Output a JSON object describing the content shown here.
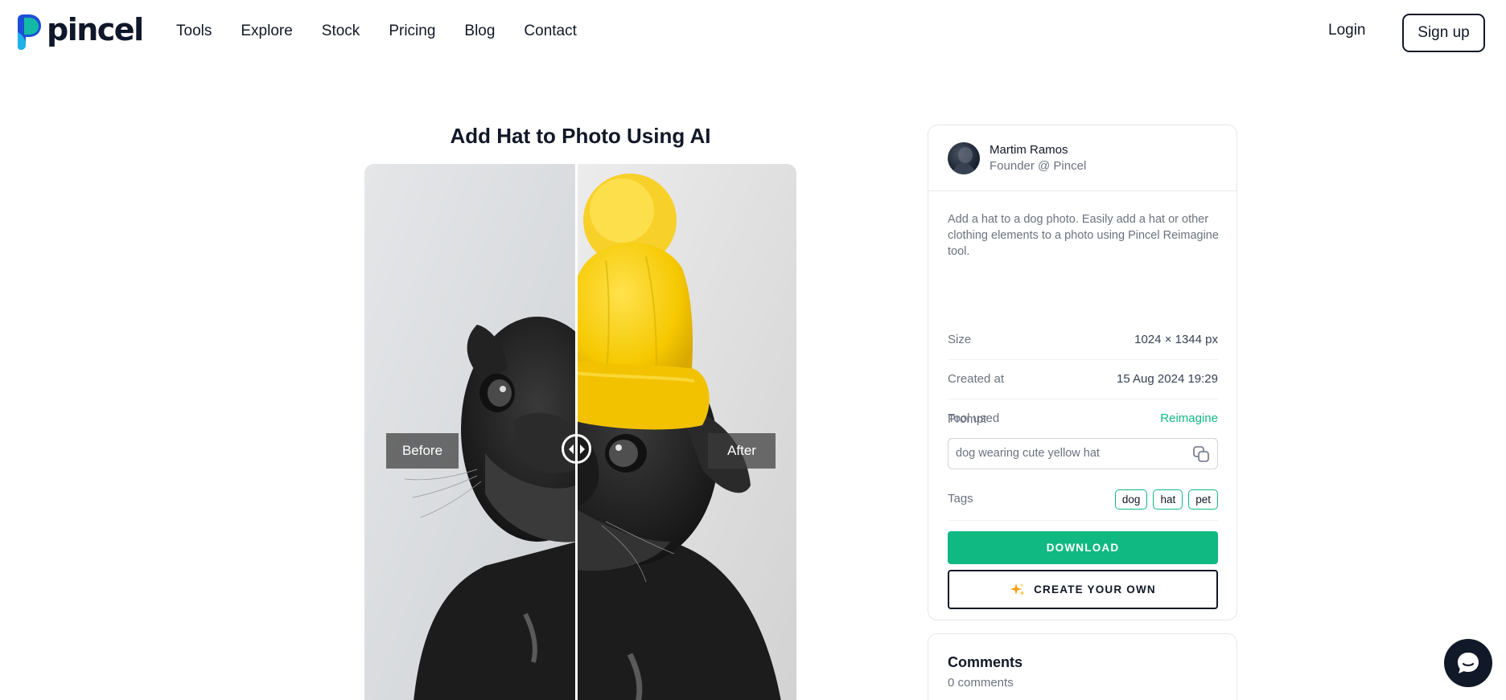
{
  "brand": {
    "name": "pincel",
    "accent": "#10b981",
    "logo_blue": "#1d4ed8",
    "logo_teal": "#14b8a6"
  },
  "nav": {
    "links": [
      "Tools",
      "Explore",
      "Stock",
      "Pricing",
      "Blog",
      "Contact"
    ],
    "login_label": "Login",
    "signup_label": "Sign up"
  },
  "main": {
    "title": "Add Hat to Photo Using AI",
    "compare": {
      "before_label": "Before",
      "after_label": "After",
      "handle_icon": "arrows-horizontal-icon"
    }
  },
  "sidebar": {
    "author": {
      "name": "Martim Ramos",
      "role": "Founder @ Pincel"
    },
    "description": "Add a hat to a dog photo. Easily add a hat or other clothing elements to a photo using Pincel Reimagine tool.",
    "details": [
      {
        "key": "Size",
        "value": "1024 × 1344 px"
      },
      {
        "key": "Created at",
        "value": "15 Aug 2024 19:29"
      },
      {
        "key": "Tool used",
        "value": "Reimagine"
      }
    ],
    "prompt": {
      "label": "Prompt",
      "value": "dog wearing cute yellow hat",
      "copy_icon": "copy-icon"
    },
    "tags": {
      "label": "Tags",
      "items": [
        "dog",
        "hat",
        "pet"
      ]
    },
    "download_label": "DOWNLOAD",
    "create_label": "CREATE YOUR OWN",
    "create_icon": "sparkles-icon"
  },
  "comments": {
    "title": "Comments",
    "count": "0 comments"
  },
  "chat": {
    "icon": "chat-bubble-icon"
  }
}
